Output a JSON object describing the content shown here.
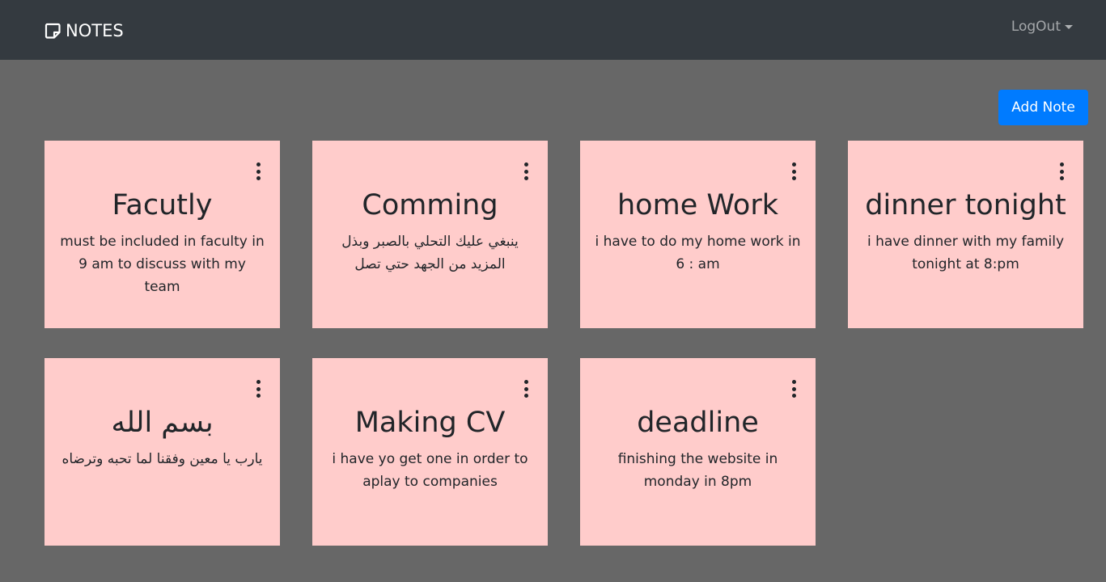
{
  "navbar": {
    "brand": "NOTES",
    "brand_icon": "sticky-note-icon",
    "logout_label": "LogOut",
    "logout_icon": "caret-down-icon",
    "background": "#343a40"
  },
  "add_note_label": "Add Note",
  "colors": {
    "page_background": "#676767",
    "note_background": "#ffcccb",
    "primary": "#007bff"
  },
  "notes": [
    {
      "title": "Facutly",
      "body": "must be included in faculty in 9 am to discuss with my team"
    },
    {
      "title": "Comming",
      "body": "ينبغي عليك التحلي بالصبر وبذل المزيد من الجهد حتي تصل"
    },
    {
      "title": "home Work",
      "body": "i have to do my home work in 6 : am"
    },
    {
      "title": "dinner tonight",
      "body": "i have dinner with my family tonight at 8:pm"
    },
    {
      "title": "بسم الله",
      "body": "يارب يا معين وفقنا لما تحبه وترضاه"
    },
    {
      "title": "Making CV",
      "body": "i have yo get one in order to aplay to companies"
    },
    {
      "title": "deadline",
      "body": "finishing the website in monday in 8pm"
    }
  ]
}
